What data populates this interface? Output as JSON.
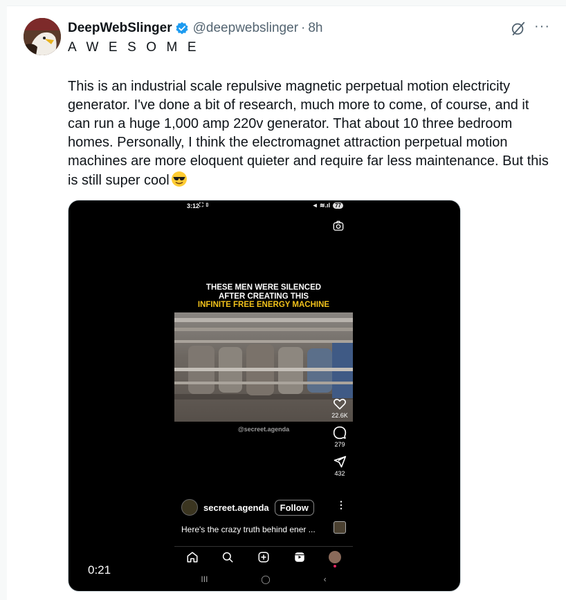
{
  "tweet": {
    "display_name": "DeepWebSlinger",
    "handle": "@deepwebslinger",
    "separator": "·",
    "time": "8h",
    "subtitle": "AWESOME",
    "text": "This is an industrial scale repulsive magnetic perpetual motion electricity generator. I've done a bit of research, much more to come, of course, and it can run a huge 1,000 amp 220v generator. That about 10 three bedroom homes. Personally, I think the electromagnet attraction perpetual motion machines are more eloquent quieter and require far less maintenance. But this is still super cool",
    "emoji": "smiling-face-with-sunglasses",
    "more_label": "···",
    "colors": {
      "text": "#0f1419",
      "secondary": "#536471",
      "verified": "#1d9bf0"
    }
  },
  "media": {
    "duration": "0:21",
    "phone": {
      "status_time": "3:12",
      "status_icons": "⛶ ▯",
      "status_right": "◄ ≋.ıl",
      "battery": "77",
      "caption_line1": "THESE MEN WERE SILENCED",
      "caption_line2": "AFTER CREATING THIS",
      "caption_line3": "INFINITE FREE ENERGY MACHINE",
      "watermark": "@secreet.agenda",
      "likes": "22.6K",
      "comments": "279",
      "shares": "432",
      "username": "secreet.agenda",
      "follow_label": "Follow",
      "reel_more": "⋮",
      "caption": "Here's the crazy truth behind ener ...",
      "android_nav": [
        "III",
        "◯",
        "‹"
      ],
      "colors": {
        "caption_yellow": "#f2c21b"
      }
    }
  }
}
